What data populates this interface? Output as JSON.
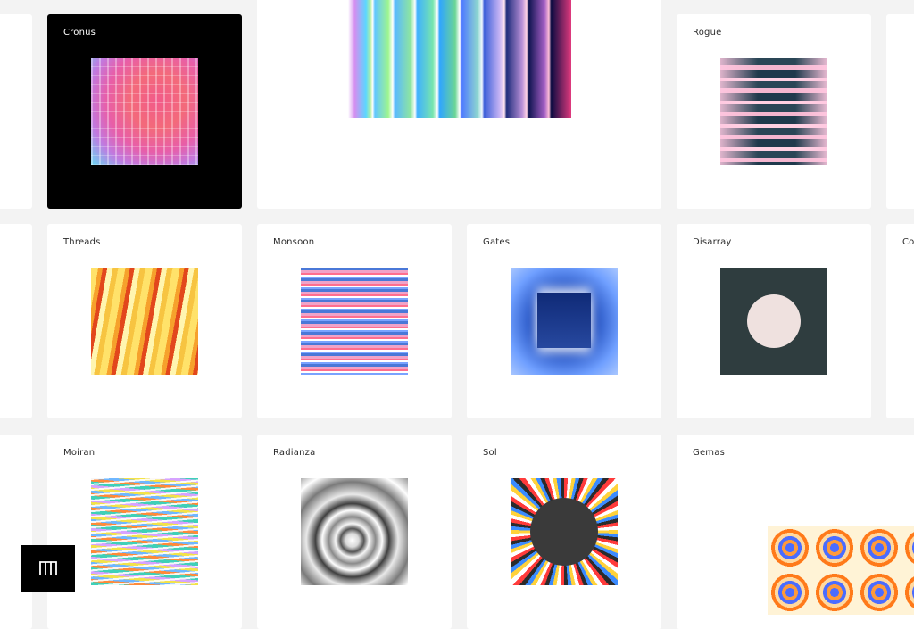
{
  "cards": {
    "cronus": "Cronus",
    "rogue": "Rogue",
    "threads": "Threads",
    "monsoon": "Monsoon",
    "gates": "Gates",
    "disarray": "Disarray",
    "partial_right": "Co",
    "moiran": "Moiran",
    "radianza": "Radianza",
    "sol": "Sol",
    "gemas": "Gemas"
  },
  "logo_icon": "m-logo-icon",
  "colors": {
    "page_bg": "#f3f3f3",
    "card_bg": "#ffffff",
    "dark_card_bg": "#000000"
  }
}
